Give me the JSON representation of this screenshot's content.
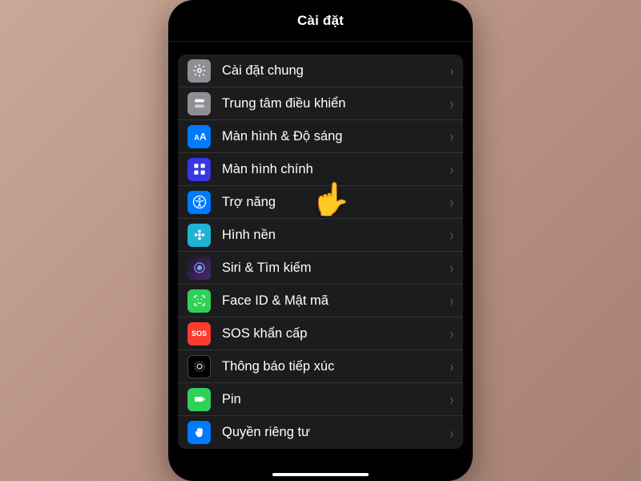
{
  "header": {
    "title": "Cài đặt"
  },
  "pointer": "👆",
  "rows": [
    {
      "id": "general",
      "label": "Cài đặt chung",
      "icon": "gear-icon",
      "bg": "bg-gray"
    },
    {
      "id": "control-center",
      "label": "Trung tâm điều khiển",
      "icon": "toggles-icon",
      "bg": "bg-gray2"
    },
    {
      "id": "display",
      "label": "Màn hình & Độ sáng",
      "icon": "text-size-icon",
      "bg": "bg-blue"
    },
    {
      "id": "home-screen",
      "label": "Màn hình chính",
      "icon": "grid-icon",
      "bg": "bg-indigo"
    },
    {
      "id": "accessibility",
      "label": "Trợ năng",
      "icon": "accessibility-icon",
      "bg": "bg-blue2"
    },
    {
      "id": "wallpaper",
      "label": "Hình nền",
      "icon": "flower-icon",
      "bg": "bg-cyan"
    },
    {
      "id": "siri",
      "label": "Siri & Tìm kiếm",
      "icon": "siri-icon",
      "bg": "bg-siri"
    },
    {
      "id": "face-id",
      "label": "Face ID & Mật mã",
      "icon": "faceid-icon",
      "bg": "bg-green"
    },
    {
      "id": "sos",
      "label": "SOS khẩn cấp",
      "icon": "sos-icon",
      "bg": "bg-red"
    },
    {
      "id": "exposure",
      "label": "Thông báo tiếp xúc",
      "icon": "exposure-icon",
      "bg": "bg-black"
    },
    {
      "id": "battery",
      "label": "Pin",
      "icon": "battery-icon",
      "bg": "bg-green2"
    },
    {
      "id": "privacy",
      "label": "Quyền riêng tư",
      "icon": "hand-icon",
      "bg": "bg-blue3"
    }
  ]
}
